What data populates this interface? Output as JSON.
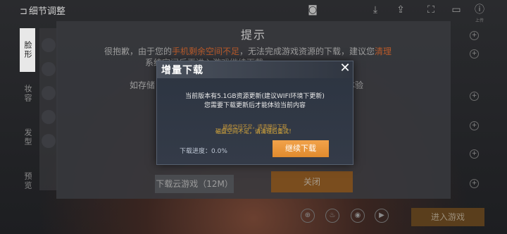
{
  "topbar": {
    "back_label": "细节调整",
    "icons": [
      "download-icon",
      "share-icon",
      "avatar-frame-icon",
      "screen-icon",
      "info-icon"
    ],
    "brand_label": "上传"
  },
  "sidebar": {
    "items": [
      {
        "label": "脸形"
      },
      {
        "label": "妆容"
      },
      {
        "label": "发型"
      },
      {
        "label": "预览"
      }
    ]
  },
  "tip_dialog": {
    "title": "提示",
    "line1_prefix": "很抱歉，由于您的",
    "line1_highlight": "手机剩余空间不足",
    "line1_suffix": "，无法完成游戏资源的下载，建议您",
    "line1_highlight2": "清理",
    "line2": "系统空间后再进入游戏继续下载",
    "line3_prefix": "如存储",
    "line3_suffix": "体验",
    "cloud_button": "下载云游戏（12M）",
    "close_button": "关闭"
  },
  "bottom": {
    "enter_button": "进入游戏"
  },
  "modal": {
    "title": "增量下载",
    "line1": "当前版本有5.1GB资源更新(建议WIFI环境下更新)",
    "line2": "您需要下载更新后才能体验当前内容",
    "warn_shadow": "磁盘空间不足，请清理后下载",
    "warn": "磁盘空间不足，请清理后重试！",
    "progress": "下载进度：0.0%",
    "continue_button": "继续下载"
  },
  "colors": {
    "accent": "#e8983a",
    "warn": "#e8b339",
    "modal_bg": "#2f3744"
  }
}
